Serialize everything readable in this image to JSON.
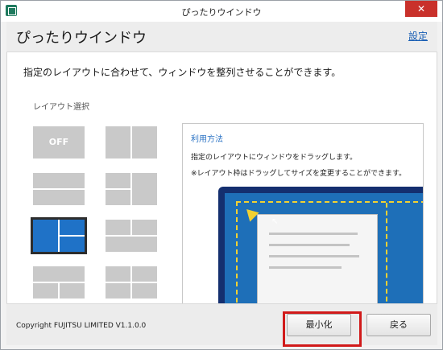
{
  "window": {
    "title": "ぴったりウインドウ",
    "close_glyph": "✕"
  },
  "header": {
    "title": "ぴったりウインドウ",
    "settings_link": "設定"
  },
  "main": {
    "description": "指定のレイアウトに合わせて、ウィンドウを整列させることができます。",
    "layout_label": "レイアウト選択",
    "off_label": "OFF",
    "selected_layout": 5
  },
  "usage": {
    "title": "利用方法",
    "line1": "指定のレイアウトにウィンドウをドラッグします。",
    "line2": "※レイアウト枠はドラッグしてサイズを変更することができます。"
  },
  "footer": {
    "copyright": "Copyright FUJITSU LIMITED V1.1.0.0",
    "minimize_label": "最小化",
    "back_label": "戻る"
  },
  "colors": {
    "selected_layout": "#1f72c7",
    "layout_cell": "#c9c9c9",
    "link": "#1a5fb4",
    "highlight": "#d11a1a",
    "close_button": "#c9312b"
  }
}
